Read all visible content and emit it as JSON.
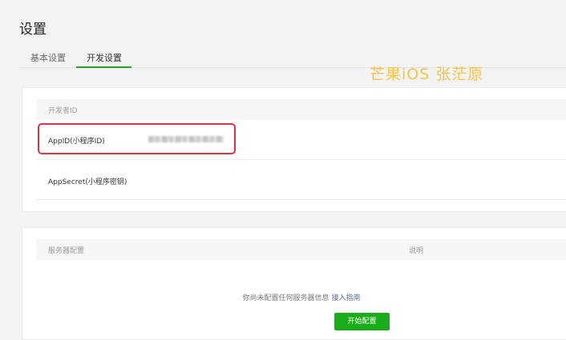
{
  "header": {
    "title": "设置"
  },
  "tabs": [
    {
      "label": "基本设置"
    },
    {
      "label": "开发设置"
    }
  ],
  "watermark": "芒果iOS 张茫原",
  "developer_id": {
    "section_title": "开发者ID",
    "rows": [
      {
        "label": "AppID(小程序ID)"
      },
      {
        "label": "AppSecret(小程序密钥)"
      }
    ]
  },
  "server_config": {
    "section_title": "服务器配置",
    "column_description": "说明",
    "empty_message": "你尚未配置任何服务器信息",
    "guide_link": "接入指南",
    "start_button": "开始配置"
  },
  "colors": {
    "accent_green": "#1aad19",
    "highlight_red": "#e23344",
    "link_blue": "#576b95",
    "watermark_yellow": "#f6c343"
  }
}
